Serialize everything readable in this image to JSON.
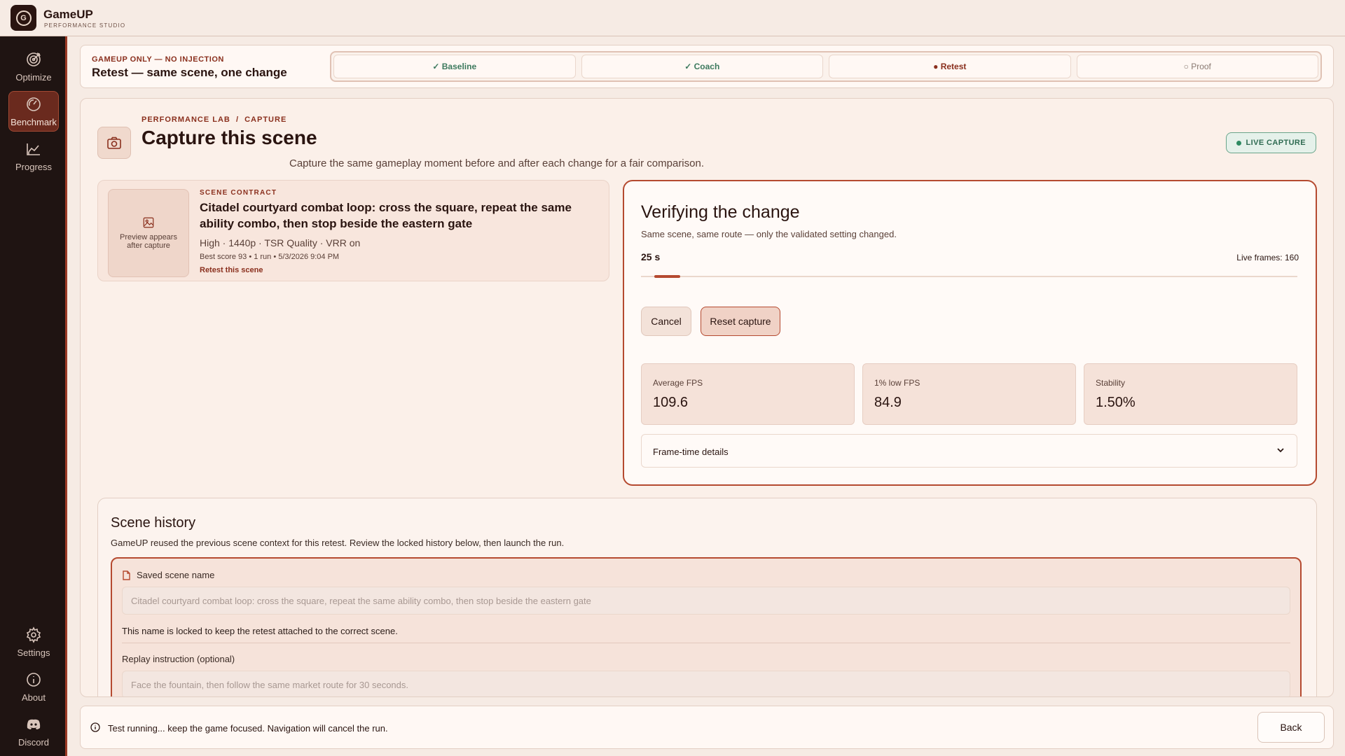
{
  "app": {
    "name": "GameUP",
    "subtitle": "PERFORMANCE STUDIO",
    "logo_letter": "G"
  },
  "sidebar": {
    "items": [
      {
        "label": "Optimize",
        "icon": "target-icon",
        "active": false
      },
      {
        "label": "Benchmark",
        "icon": "gauge-icon",
        "active": true
      },
      {
        "label": "Progress",
        "icon": "chart-icon",
        "active": false
      },
      {
        "label": "Settings",
        "icon": "gear-icon",
        "active": false
      },
      {
        "label": "About",
        "icon": "info-icon",
        "active": false
      },
      {
        "label": "Discord",
        "icon": "discord-icon",
        "active": false
      }
    ]
  },
  "stepper": {
    "kicker": "GAMEUP ONLY — NO INJECTION",
    "title": "Retest — same scene, one change",
    "steps": [
      {
        "label": "✓ Baseline",
        "state": "done"
      },
      {
        "label": "✓ Coach",
        "state": "done"
      },
      {
        "label": "● Retest",
        "state": "current"
      },
      {
        "label": "○ Proof",
        "state": "todo"
      }
    ]
  },
  "header": {
    "breadcrumb": "PERFORMANCE LAB  /  CAPTURE",
    "title": "Capture this scene",
    "subtitle": "Capture the same gameplay moment before and after each change for a fair comparison.",
    "badge": "LIVE CAPTURE"
  },
  "scene_contract": {
    "kicker": "SCENE CONTRACT",
    "preview_text": "Preview appears after capture",
    "title": "Citadel courtyard combat loop: cross the square, repeat the same ability combo, then stop beside the eastern gate",
    "meta": "High · 1440p · TSR Quality · VRR on",
    "best": "Best score 93 • 1 run • 5/3/2026 9:04 PM",
    "link": "Retest this scene"
  },
  "verify": {
    "title": "Verifying the change",
    "subtitle": "Same scene, same route — only the validated setting changed.",
    "elapsed": "25 s",
    "live_frames": "Live frames: 160",
    "progress": 0.04,
    "cancel_label": "Cancel",
    "reset_label": "Reset capture",
    "metrics": [
      {
        "label": "Average FPS",
        "value": "109.6"
      },
      {
        "label": "1% low FPS",
        "value": "84.9"
      },
      {
        "label": "Stability",
        "value": "1.50%"
      }
    ],
    "details_label": "Frame-time details"
  },
  "history": {
    "title": "Scene history",
    "subtitle": "GameUP reused the previous scene context for this retest. Review the locked history below, then launch the run.",
    "name_label": "Saved scene name",
    "name_value": "Citadel courtyard combat loop: cross the square, repeat the same ability combo, then stop beside the eastern gate",
    "name_help": "This name is locked to keep the retest attached to the correct scene.",
    "replay_label": "Replay instruction (optional)",
    "replay_placeholder": "Face the fountain, then follow the same market route for 30 seconds."
  },
  "footer": {
    "status": "Test running... keep the game focused. Navigation will cancel the run.",
    "back_label": "Back"
  }
}
